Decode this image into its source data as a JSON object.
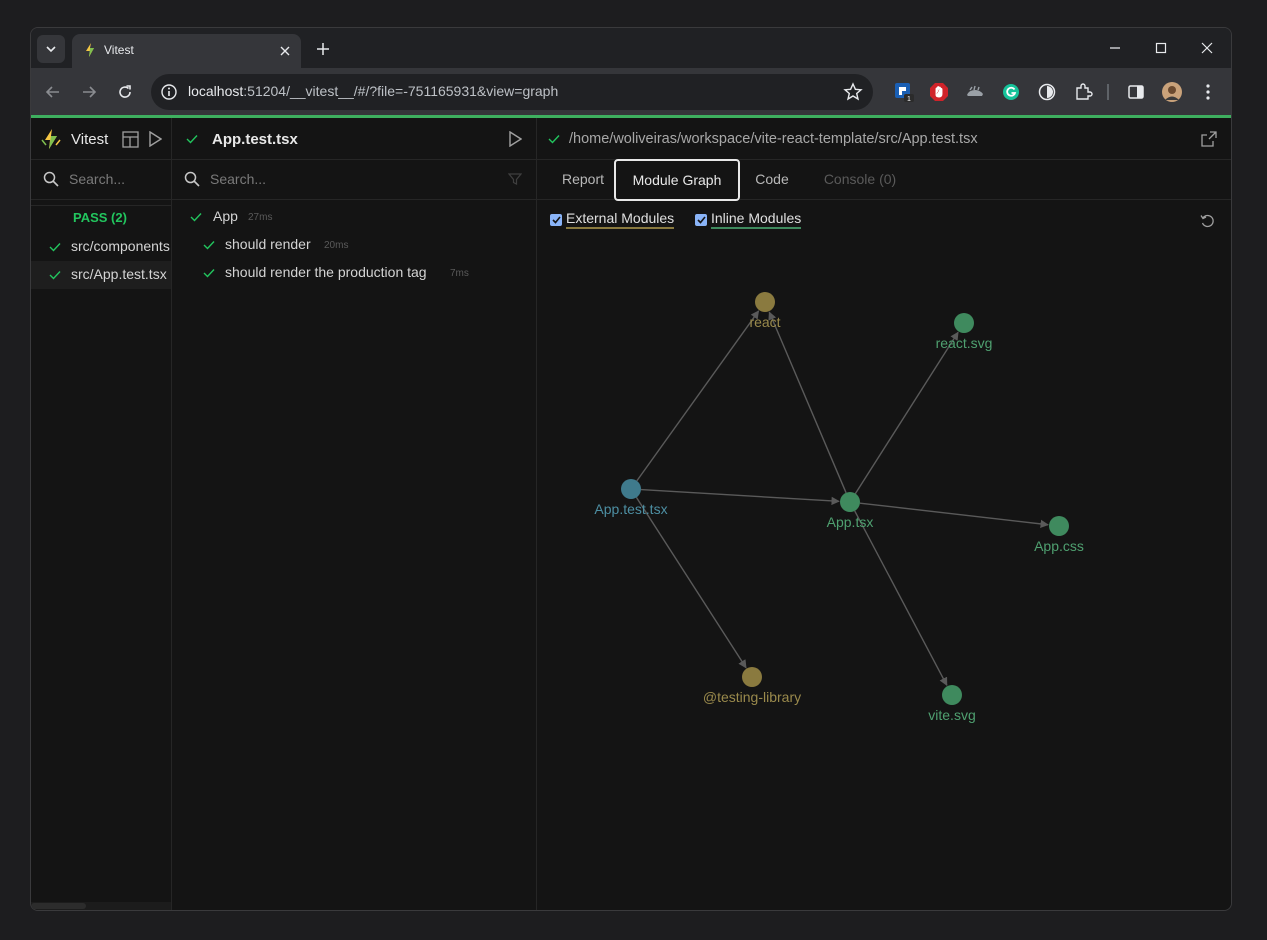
{
  "browser": {
    "tab_title": "Vitest",
    "url_host": "localhost",
    "url_rest": ":51204/__vitest__/#/?file=-751165931&view=graph"
  },
  "sidebar": {
    "app_name": "Vitest",
    "search_placeholder": "Search...",
    "pass_label": "PASS (2)",
    "files": [
      {
        "label": "src/components",
        "status": "pass"
      },
      {
        "label": "src/App.test.tsx",
        "status": "pass",
        "selected": true
      }
    ]
  },
  "tests_panel": {
    "file_title": "App.test.tsx",
    "search_placeholder": "Search...",
    "tests": [
      {
        "name": "App",
        "duration": "27ms"
      },
      {
        "name": "should render",
        "duration": "20ms"
      },
      {
        "name": "should render the production tag",
        "duration": "7ms"
      }
    ]
  },
  "detail": {
    "file_path": "/home/woliveiras/workspace/vite-react-template/src/App.test.tsx",
    "tabs": [
      {
        "label": "Report",
        "state": "normal"
      },
      {
        "label": "Module Graph",
        "state": "active"
      },
      {
        "label": "Code",
        "state": "normal"
      },
      {
        "label": "Console (0)",
        "state": "disabled"
      }
    ],
    "filters": {
      "external_modules": {
        "label": "External Modules",
        "checked": true,
        "color": "#c6a84a"
      },
      "inline_modules": {
        "label": "Inline Modules",
        "checked": true,
        "color": "#4aa36c"
      }
    },
    "graph": {
      "nodes": [
        {
          "id": "react",
          "label": "react",
          "type": "external"
        },
        {
          "id": "react.svg",
          "label": "react.svg",
          "type": "inline"
        },
        {
          "id": "App.test.tsx",
          "label": "App.test.tsx",
          "type": "root"
        },
        {
          "id": "App.tsx",
          "label": "App.tsx",
          "type": "inline"
        },
        {
          "id": "App.css",
          "label": "App.css",
          "type": "inline"
        },
        {
          "id": "@testing-library",
          "label": "@testing-library",
          "type": "external"
        },
        {
          "id": "vite.svg",
          "label": "vite.svg",
          "type": "inline"
        }
      ],
      "edges": [
        [
          "App.test.tsx",
          "react"
        ],
        [
          "App.test.tsx",
          "App.tsx"
        ],
        [
          "App.test.tsx",
          "@testing-library"
        ],
        [
          "App.tsx",
          "react"
        ],
        [
          "App.tsx",
          "react.svg"
        ],
        [
          "App.tsx",
          "App.css"
        ],
        [
          "App.tsx",
          "vite.svg"
        ]
      ],
      "colors": {
        "external": "#8a7a3f",
        "inline": "#3f8a5e",
        "root": "#3f7a8c",
        "edge": "#5a5a5a"
      }
    }
  },
  "icons": [
    "tab-search-icon",
    "vitest-logo-icon",
    "close-icon",
    "plus-icon",
    "minimize-icon",
    "maximize-icon",
    "window-close-icon",
    "back-icon",
    "forward-icon",
    "reload-icon",
    "site-info-icon",
    "star-icon",
    "extension-icon",
    "sidebar-icon",
    "profile-avatar",
    "menu-icon",
    "dashboard-icon",
    "play-icon",
    "search-icon",
    "check-icon",
    "filter-icon",
    "external-link-icon",
    "reset-icon"
  ]
}
